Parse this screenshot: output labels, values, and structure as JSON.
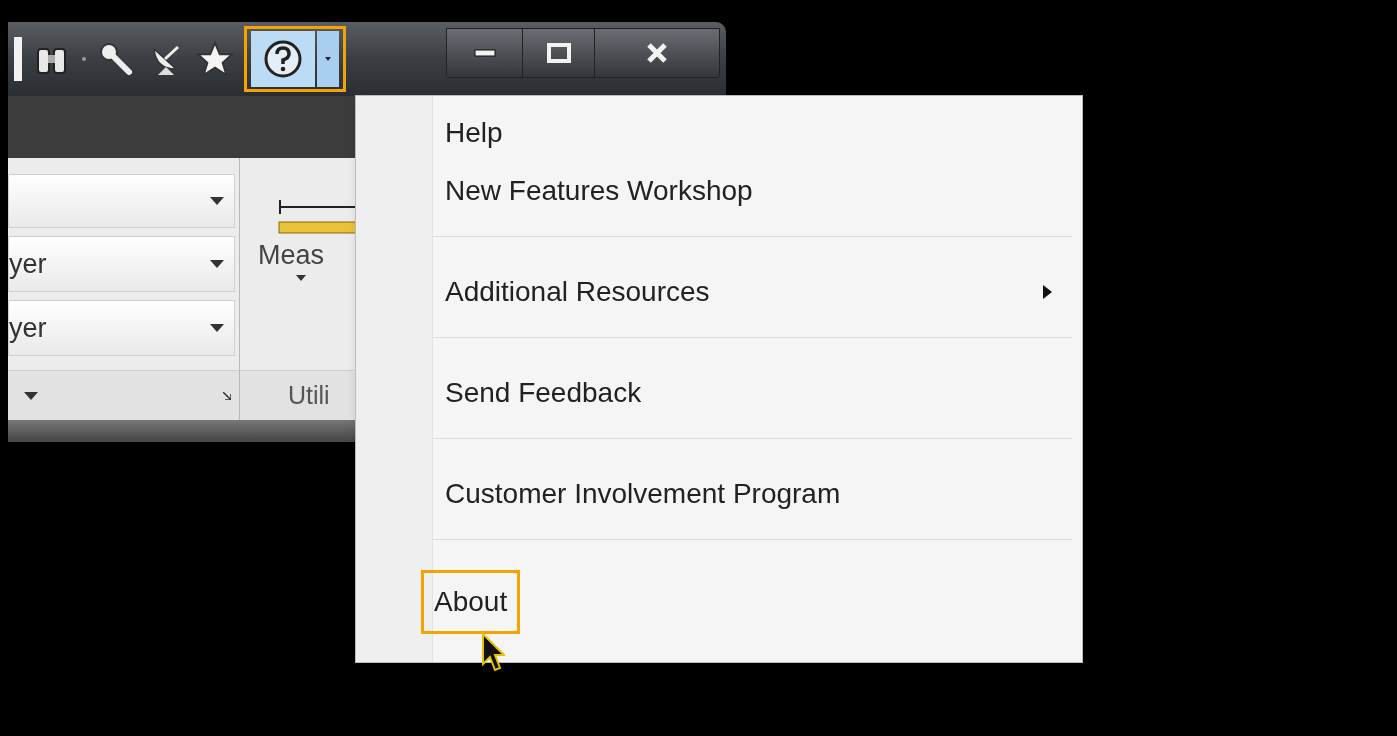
{
  "quick_access": {
    "help_selected": true
  },
  "ribbon": {
    "layer_combos": [
      "yer",
      "yer"
    ],
    "measure_label": "Meas",
    "panel_title": "Utili"
  },
  "help_menu": {
    "groups": [
      [
        {
          "label": "Help",
          "submenu": false,
          "highlighted": false
        },
        {
          "label": "New Features Workshop",
          "submenu": false,
          "highlighted": false
        }
      ],
      [
        {
          "label": "Additional Resources",
          "submenu": true,
          "highlighted": false
        }
      ],
      [
        {
          "label": "Send Feedback",
          "submenu": false,
          "highlighted": false
        }
      ],
      [
        {
          "label": "Customer Involvement Program",
          "submenu": false,
          "highlighted": false
        }
      ],
      [
        {
          "label": "About",
          "submenu": false,
          "highlighted": true
        }
      ]
    ]
  }
}
